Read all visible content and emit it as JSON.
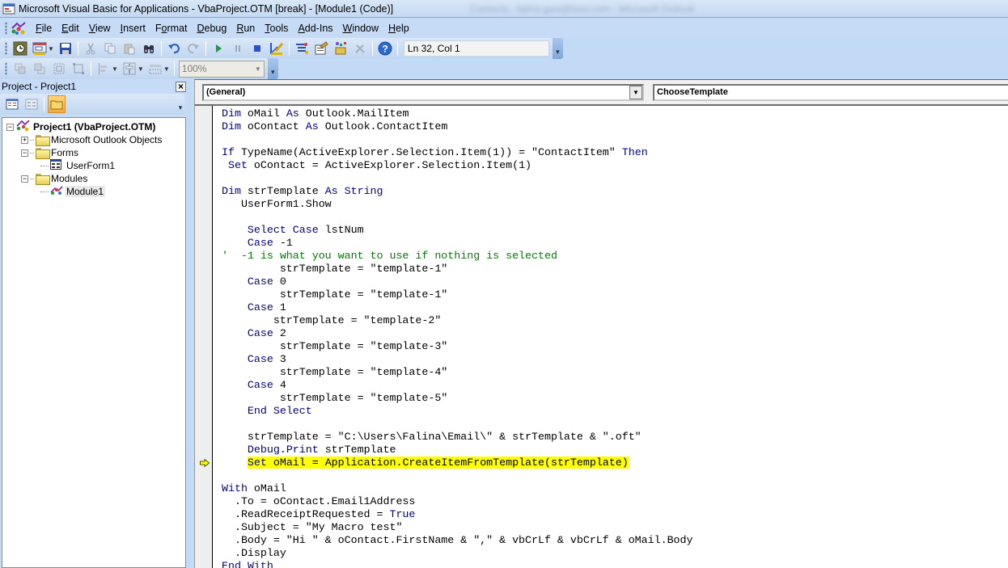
{
  "window": {
    "title": "Microsoft Visual Basic for Applications - VbaProject.OTM [break] - [Module1 (Code)]",
    "background_title": "Contacts - falina.gani@baxr.com - Microsoft Outlook"
  },
  "menu": {
    "items": [
      {
        "label": "File",
        "accel": "F"
      },
      {
        "label": "Edit",
        "accel": "E"
      },
      {
        "label": "View",
        "accel": "V"
      },
      {
        "label": "Insert",
        "accel": "I"
      },
      {
        "label": "Format",
        "accel": "o"
      },
      {
        "label": "Debug",
        "accel": "D"
      },
      {
        "label": "Run",
        "accel": "R"
      },
      {
        "label": "Tools",
        "accel": "T"
      },
      {
        "label": "Add-Ins",
        "accel": "A"
      },
      {
        "label": "Window",
        "accel": "W"
      },
      {
        "label": "Help",
        "accel": "H"
      }
    ]
  },
  "toolbar": {
    "standard_icons": [
      "view-host-app-icon",
      "insert-userform-icon",
      "save-icon",
      "cut-icon",
      "copy-icon",
      "paste-icon",
      "find-icon",
      "undo-icon",
      "redo-icon",
      "run-icon",
      "break-icon",
      "reset-icon",
      "design-mode-icon",
      "project-explorer-icon",
      "properties-window-icon",
      "object-browser-icon",
      "toolbox-icon",
      "help-icon"
    ],
    "cursor_position": "Ln 32, Col 1",
    "zoom_value": "100%"
  },
  "project": {
    "title": "Project - Project1",
    "close_label": "×",
    "tree": [
      {
        "label": "Project1 (VbaProject.OTM)",
        "level": 0,
        "expander": "−",
        "icon": "vba-project-icon",
        "bold": true
      },
      {
        "label": "Microsoft Outlook Objects",
        "level": 1,
        "expander": "+",
        "icon": "folder-icon"
      },
      {
        "label": "Forms",
        "level": 1,
        "expander": "−",
        "icon": "folder-open-icon"
      },
      {
        "label": "UserForm1",
        "level": 2,
        "icon": "userform-icon"
      },
      {
        "label": "Modules",
        "level": 1,
        "expander": "−",
        "icon": "folder-open-icon"
      },
      {
        "label": "Module1",
        "level": 2,
        "icon": "module-icon",
        "selected": true
      }
    ]
  },
  "code_window": {
    "object_combo": "(General)",
    "procedure_combo": "ChooseTemplate",
    "current_line_index": 27,
    "lines": [
      "Dim oMail As Outlook.MailItem",
      "Dim oContact As Outlook.ContactItem",
      "",
      "If TypeName(ActiveExplorer.Selection.Item(1)) = \"ContactItem\" Then",
      " Set oContact = ActiveExplorer.Selection.Item(1)",
      "",
      "Dim strTemplate As String",
      "   UserForm1.Show",
      "",
      "    Select Case lstNum",
      "    Case -1",
      "'  -1 is what you want to use if nothing is selected",
      "         strTemplate = \"template-1\"",
      "    Case 0",
      "         strTemplate = \"template-1\"",
      "    Case 1",
      "        strTemplate = \"template-2\"",
      "    Case 2",
      "         strTemplate = \"template-3\"",
      "    Case 3",
      "         strTemplate = \"template-4\"",
      "    Case 4",
      "         strTemplate = \"template-5\"",
      "    End Select",
      "",
      "    strTemplate = \"C:\\Users\\Falina\\Email\\\" & strTemplate & \".oft\"",
      "    Debug.Print strTemplate",
      "    Set oMail = Application.CreateItemFromTemplate(strTemplate)",
      "",
      "With oMail",
      "  .To = oContact.Email1Address",
      "  .ReadReceiptRequested = True",
      "  .Subject = \"My Macro test\"",
      "  .Body = \"Hi \" & oContact.FirstName & \",\" & vbCrLf & vbCrLf & oMail.Body",
      "  .Display",
      "End With"
    ],
    "keywords": [
      "Dim",
      "As",
      "If",
      "Then",
      "Set",
      "String",
      "Select",
      "Case",
      "End",
      "With",
      "True",
      "Debug",
      "Print"
    ],
    "colors": {
      "keyword": "#00008b",
      "comment": "#008000",
      "execution_highlight": "#ffff00"
    }
  }
}
